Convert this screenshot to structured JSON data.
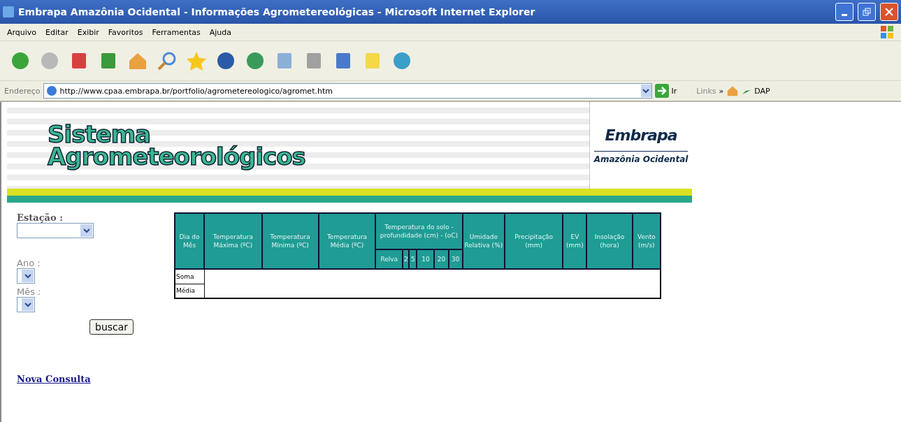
{
  "window": {
    "title": "Embrapa Amazônia Ocidental - Informações Agrometereológicas - Microsoft Internet Explorer"
  },
  "menu": [
    "Arquivo",
    "Editar",
    "Exibir",
    "Favoritos",
    "Ferramentas",
    "Ajuda"
  ],
  "address_bar": {
    "label": "Endereço",
    "url": "http://www.cpaa.embrapa.br/portfolio/agrometereologico/agromet.htm",
    "go": "Ir",
    "links_label": "Links",
    "chevron": "»",
    "link": "DAP"
  },
  "banner": {
    "title_lines": [
      "Sistema",
      "Agrometeorológicos"
    ],
    "logo": "Embrapa",
    "logo_subtitle": "Amazônia Ocidental"
  },
  "form": {
    "fields": [
      {
        "label": "Estação :",
        "kind": "wide"
      },
      {
        "label": "Ano :",
        "kind": "narrow"
      },
      {
        "label": "Mês :",
        "kind": "narrow"
      }
    ],
    "button": "buscar",
    "link": "Nova Consulta"
  },
  "table": {
    "columns": [
      {
        "label": "Dia do Mês"
      },
      {
        "label": "Temperatura Máxima (ºC)"
      },
      {
        "label": "Temperatura Mínima (ºC)"
      },
      {
        "label": "Temperatura Média (ºC)"
      },
      {
        "label": "Temperatura do solo - profundidade (cm) - (oC)",
        "children": [
          "Relva",
          "2",
          "5",
          "10",
          "20",
          "30"
        ]
      },
      {
        "label": "Umidade Relativa (%)"
      },
      {
        "label": "Precipitação (mm)"
      },
      {
        "label": "EV (mm)"
      },
      {
        "label": "Insolação (hora)"
      },
      {
        "label": "Vento (m/s)"
      }
    ],
    "rows": [
      "Soma",
      "Média"
    ]
  }
}
